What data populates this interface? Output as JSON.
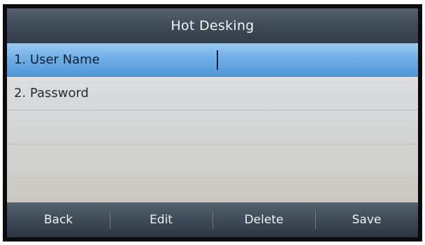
{
  "title": "Hot Desking",
  "fields": [
    {
      "label": "1. User Name",
      "value": "",
      "selected": true
    },
    {
      "label": "2. Password",
      "value": "",
      "selected": false
    }
  ],
  "softkeys": [
    {
      "label": "Back"
    },
    {
      "label": "Edit"
    },
    {
      "label": "Delete"
    },
    {
      "label": "Save"
    }
  ]
}
